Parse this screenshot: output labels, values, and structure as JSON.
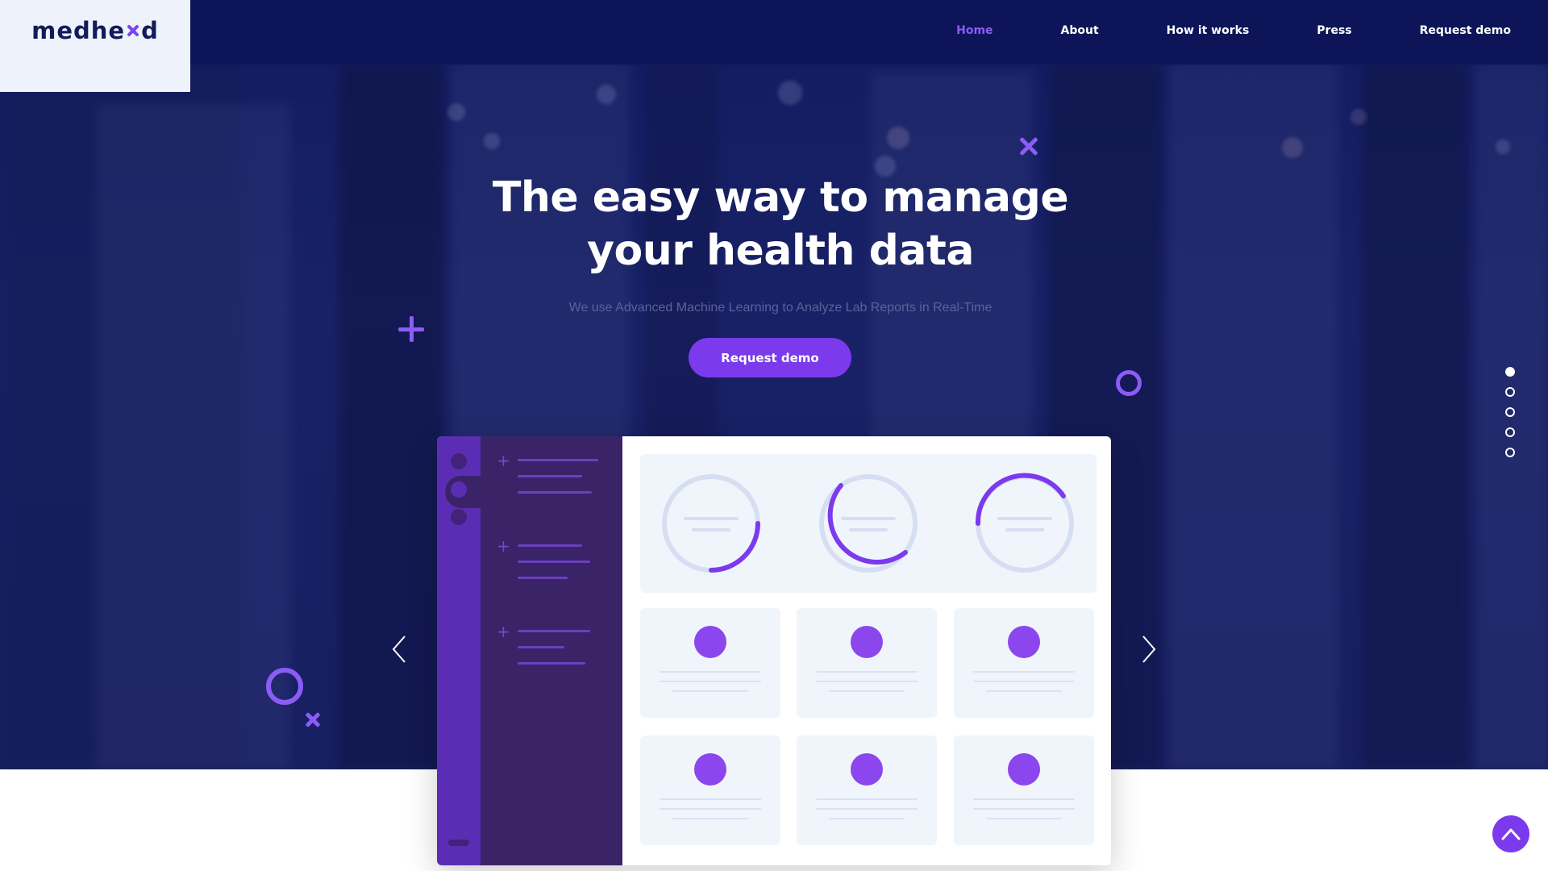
{
  "brand": {
    "logo_prefix": "medhe",
    "logo_suffix": "d"
  },
  "nav": {
    "items": [
      {
        "label": "Home",
        "active": true
      },
      {
        "label": "About",
        "active": false
      },
      {
        "label": "How it works",
        "active": false
      },
      {
        "label": "Press",
        "active": false
      },
      {
        "label": "Request demo",
        "active": false
      }
    ]
  },
  "hero": {
    "title_line1": "The easy way to manage",
    "title_line2": "your health data",
    "subtitle": "We use Advanced Machine Learning to Analyze Lab Reports in Real-Time",
    "cta_label": "Request demo"
  },
  "slider": {
    "slide_count": 5,
    "active_index": 0
  },
  "colors": {
    "accent": "#7c3aed",
    "nav_bg": "#0d1558",
    "hero_bg": "#1b2468",
    "logo_bg": "#eef3fb"
  },
  "icons": [
    "x-mark-icon",
    "plus-icon",
    "ring-icon",
    "chevron-left-icon",
    "chevron-right-icon",
    "chevron-up-icon"
  ]
}
